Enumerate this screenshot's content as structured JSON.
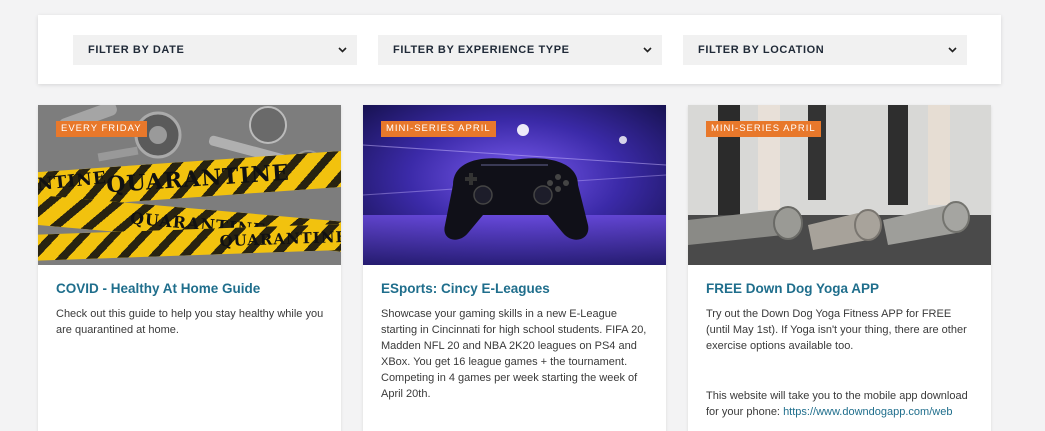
{
  "filters": [
    {
      "label": "FILTER BY DATE",
      "icon": "chevron-down-icon"
    },
    {
      "label": "FILTER BY EXPERIENCE TYPE",
      "icon": "chevron-down-icon"
    },
    {
      "label": "FILTER BY LOCATION",
      "icon": "chevron-down-icon"
    }
  ],
  "cards": [
    {
      "badge": "EVERY FRIDAY",
      "title": "COVID - Healthy At Home Guide",
      "description": "Check out this guide to help you stay healthy while you are quarantined at home.",
      "image_text": {
        "main": "QUARANTINE",
        "left_top": "RANTINE",
        "right_top": "QUARANT",
        "left_bottom": "ARANTINE",
        "left_bottom2": "QUARANTINE",
        "right_bottom": "QUARANTINE"
      }
    },
    {
      "badge": "MINI-SERIES APRIL",
      "title": "ESports: Cincy E-Leagues",
      "description": "Showcase your gaming skills in a  new E-League starting in Cincinnati for high school students. FIFA 20, Madden NFL 20 and NBA 2K20 leagues on PS4 and XBox. You  get 16 league games + the tournament. Competing in 4 games per week starting the week of April 20th."
    },
    {
      "badge": "MINI-SERIES APRIL",
      "title": "FREE Down Dog Yoga APP",
      "description": "Try out the Down Dog Yoga Fitness APP for FREE (until May 1st). If Yoga isn't your thing, there are other exercise options available too.",
      "description2": "This website will take you to the mobile app download for your phone: ",
      "link": "https://www.downdogapp.com/web"
    }
  ],
  "colors": {
    "accent": "#e8782b",
    "title": "#1f6e8c",
    "background": "#f3f3f4"
  }
}
